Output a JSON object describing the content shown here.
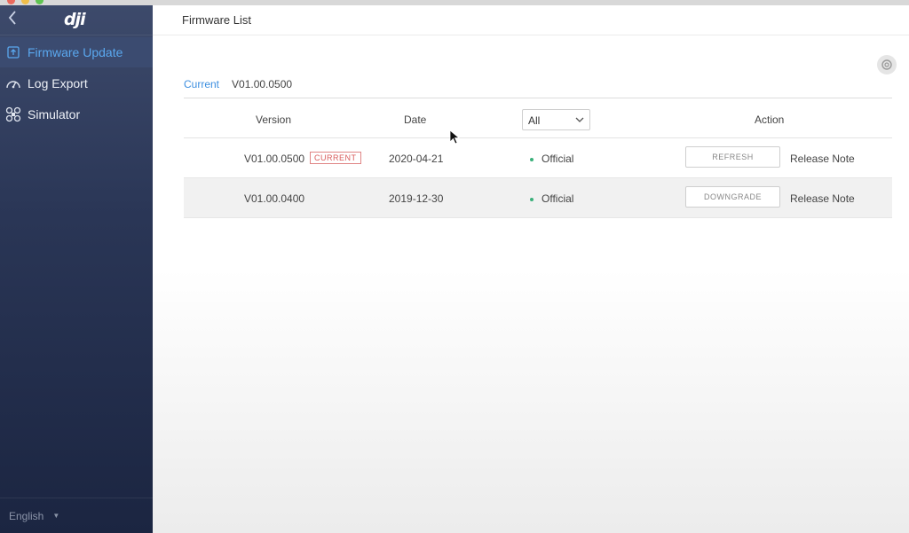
{
  "colors": {
    "accent": "#3d8fe0",
    "sidebar_bg": "#2a3656",
    "badge_red": "#d85a5a",
    "status_green": "#3ab07a"
  },
  "sidebar": {
    "back_icon": "chevron-left-icon",
    "logo": "dji",
    "items": [
      {
        "label": "Firmware Update",
        "icon": "firmware-icon",
        "active": true
      },
      {
        "label": "Log Export",
        "icon": "gauge-icon",
        "active": false
      },
      {
        "label": "Simulator",
        "icon": "drone-icon",
        "active": false
      }
    ],
    "footer": {
      "language": "English",
      "caret_icon": "caret-down-icon"
    }
  },
  "header": {
    "title": "Firmware List",
    "settings_icon": "settings-gear-icon"
  },
  "current": {
    "label": "Current",
    "version": "V01.00.0500"
  },
  "table": {
    "columns": {
      "version": "Version",
      "date": "Date",
      "action": "Action"
    },
    "filter": {
      "selected": "All",
      "icon": "chevron-down-icon"
    },
    "rows": [
      {
        "version": "V01.00.0500",
        "badge": "CURRENT",
        "date": "2020-04-21",
        "type": "Official",
        "action": "REFRESH",
        "note": "Release Note"
      },
      {
        "version": "V01.00.0400",
        "badge": "",
        "date": "2019-12-30",
        "type": "Official",
        "action": "DOWNGRADE",
        "note": "Release Note"
      }
    ]
  }
}
